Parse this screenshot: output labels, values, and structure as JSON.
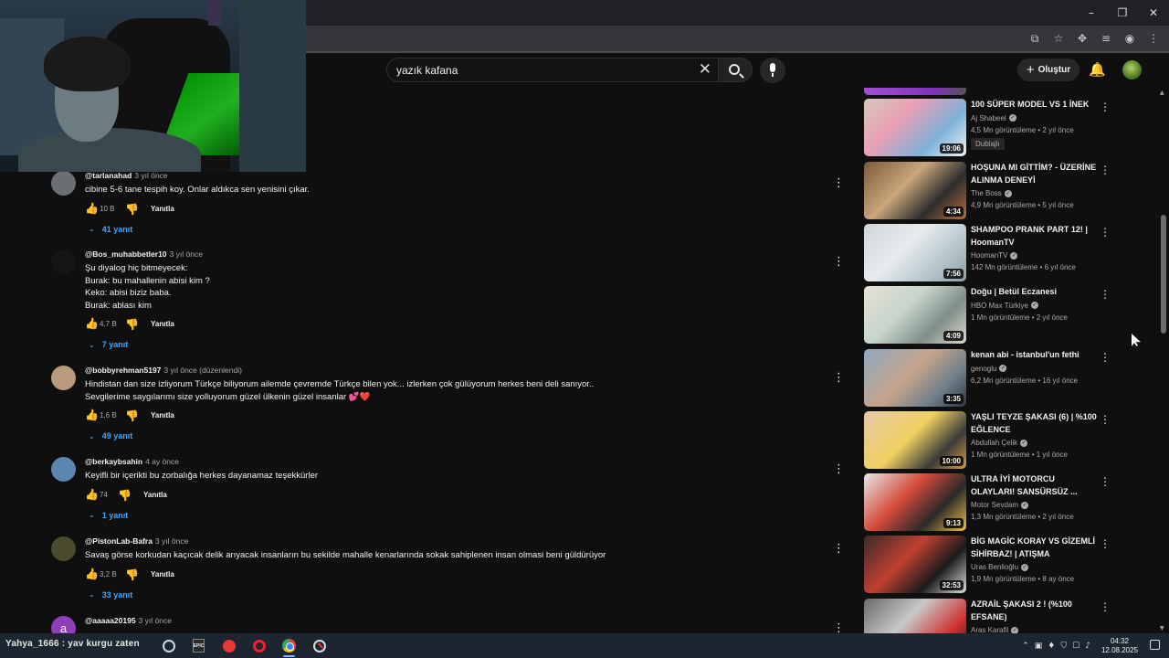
{
  "search": {
    "value": "yazık kafana"
  },
  "header": {
    "create_label": "Oluştur"
  },
  "comments": [
    {
      "author": "@tarlanahad",
      "time": "3 yıl önce",
      "text": "cibine 5-6 tane tespih koy. Onlar aldıkca sen yenisini çıkar.",
      "likes": "10 B",
      "reply_label": "Yanıtla",
      "replies": "41 yanıt",
      "avatar_color": "#6a6f74"
    },
    {
      "author": "@Bos_muhabbetler10",
      "time": "3 yıl önce",
      "text": "Şu diyalog hiç bitmeyecek:\nBurak: bu mahallenin abisi kim ?\nKeko: abisi biziz baba.\nBurak: ablası kim",
      "likes": "4,7 B",
      "reply_label": "Yanıtla",
      "replies": "7 yanıt",
      "avatar_color": "#151515"
    },
    {
      "author": "@bobbyrehman5197",
      "time": "3 yıl önce (düzenlendi)",
      "text": "Hindistan dan size izliyorum Türkçe biliyorum ailemde çevremde Türkçe bilen yok... izlerken çok gülüyorum herkes beni deli sanıyor..\nSevgilerime saygılarımı size yolluyorum güzel ülkenin güzel insanlar 💕❤️",
      "likes": "1,6 B",
      "reply_label": "Yanıtla",
      "replies": "49 yanıt",
      "avatar_color": "#b89a7c"
    },
    {
      "author": "@berkaybsahin",
      "time": "4 ay önce",
      "text": "Keyifli bir içerikti bu zorbalığa herkes dayanamaz teşekkürler",
      "likes": "74",
      "reply_label": "Yanıtla",
      "replies": "1 yanıt",
      "avatar_color": "#5b86b0"
    },
    {
      "author": "@PistonLab-Bafra",
      "time": "3 yıl önce",
      "text": "Savaş görse korkudan kaçıcak delik arıyacak insanların bu sekilde mahalle kenarlarında sokak sahiplenen insan olmasi beni güldürüyor",
      "likes": "3,2 B",
      "reply_label": "Yanıtla",
      "replies": "33 yanıt",
      "avatar_color": "#4a4a2c"
    },
    {
      "author": "@aaaaa20195",
      "time": "3 yıl önce",
      "text": "",
      "likes": "",
      "reply_label": "",
      "replies": "",
      "avatar_letter": "a",
      "avatar_color": "#8e3fb7"
    }
  ],
  "sidebar": [
    {
      "title": "100 SÜPER MODEL VS 1 İNEK",
      "channel": "Aj Shabeel",
      "meta": "4,5 Mn görüntüleme • 2 yıl önce",
      "duration": "19:06",
      "badge": "Dublajlı",
      "thumb": "linear-gradient(135deg,#d6c9b8 0%,#e9a0b6 35%,#7db2d8 70%,#f3f3f3 100%)"
    },
    {
      "title": "HOŞUNA MI GİTTİM? - ÜZERİNE ALINMA DENEYİ",
      "channel": "The Boss",
      "meta": "4,9 Mn görüntüleme • 5 yıl önce",
      "duration": "4:34",
      "badge": "",
      "thumb": "linear-gradient(135deg,#7a5a3c 0%,#c9a77a 40%,#2d2d2d 70%,#b86c3c 100%)"
    },
    {
      "title": "SHAMPOO PRANK PART 12! | HoomanTV",
      "channel": "HoomanTV",
      "meta": "142 Mn görüntüleme • 6 yıl önce",
      "duration": "7:56",
      "badge": "",
      "thumb": "linear-gradient(135deg,#cfd6da 0%,#e8ecee 40%,#b9c8cf 70%,#8e9da4 100%)"
    },
    {
      "title": "Doğu | Betül Eczanesi",
      "channel": "HBO Max Türkiye",
      "meta": "1 Mn görüntüleme • 2 yıl önce",
      "duration": "4:09",
      "badge": "",
      "thumb": "linear-gradient(135deg,#e6e1d5 0%,#c7d5cc 40%,#7f8e88 70%,#dcd8cc 100%)"
    },
    {
      "title": "kenan abi - istanbul'un fethi",
      "channel": "genoglu",
      "meta": "6,2 Mn görüntüleme • 16 yıl önce",
      "duration": "3:35",
      "badge": "",
      "thumb": "linear-gradient(135deg,#8fa8c0 0%,#c5a48a 45%,#6f7e8c 75%,#2a3440 100%)"
    },
    {
      "title": "YAŞLI TEYZE ŞAKASI (6) | %100 EĞLENCE",
      "channel": "Abdullah Çelik",
      "meta": "1 Mn görüntüleme • 1 yıl önce",
      "duration": "10:00",
      "badge": "",
      "thumb": "linear-gradient(135deg,#e6c9a8 0%,#f0d060 45%,#3a3a3a 75%,#d9a040 100%)"
    },
    {
      "title": "ULTRA İYİ MOTORCU OLAYLARI! SANSÜRSÜZ ...",
      "channel": "Motor Sevdam",
      "meta": "1,3 Mn görüntüleme • 2 yıl önce",
      "duration": "9:13",
      "badge": "",
      "thumb": "linear-gradient(135deg,#e8e8e8 0%,#d44a3a 40%,#2a2a2a 70%,#f0c040 100%)"
    },
    {
      "title": "BİG MAGİC KORAY VS GİZEMLİ SİHİRBAZ! | ATIŞMA",
      "channel": "Uras Benlioğlu",
      "meta": "1,9 Mn görüntüleme • 8 ay önce",
      "duration": "32:53",
      "badge": "",
      "thumb": "linear-gradient(135deg,#3a2a2a 0%,#c04030 40%,#1a1a1a 70%,#e0e0e0 100%)"
    },
    {
      "title": "AZRAİL ŞAKASI 2 ! (%100 EFSANE)",
      "channel": "Aras Karafil",
      "meta": "",
      "duration": "",
      "badge": "",
      "thumb": "linear-gradient(135deg,#6a6a6a 0%,#c8c8c8 40%,#d03030 75%,#202020 100%)"
    }
  ],
  "taskbar": {
    "ticker": "Yahya_1666 : yav kurgu zaten",
    "time": "04:32",
    "date": "12.08.2025"
  },
  "icons": {
    "minimize": "–",
    "restore": "❐",
    "close": "✕",
    "like": "👍",
    "dislike": "👎",
    "more": "⋮",
    "chevron": "⌄",
    "bell": "🔔",
    "clear": "✕",
    "verified": "✓"
  }
}
